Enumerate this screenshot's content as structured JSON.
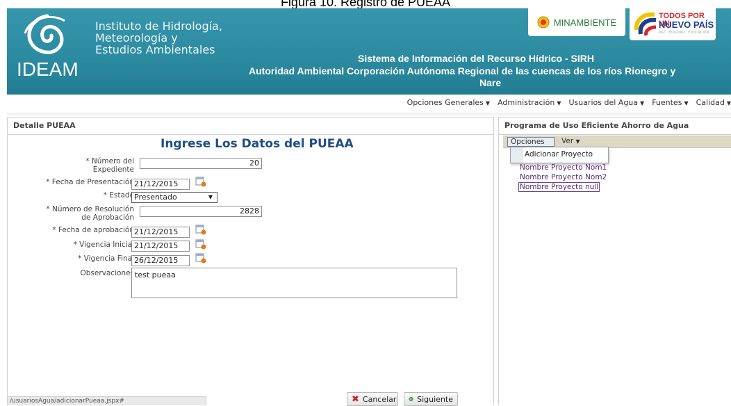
{
  "caption": "Figura 10. Registro de PUEAA",
  "header": {
    "logo_text": "IDEAM",
    "institution_lines": [
      "Instituto de Hidrología,",
      "Meteorología y",
      "Estudios Ambientales"
    ],
    "system_title": "Sistema de Información del Recurso Hídrico - SIRH",
    "authority_line1": "Autoridad Ambiental Corporación Autónoma Regional de las cuencas de los ríos Rionegro y",
    "authority_line2": "Nare",
    "ministry_logo": "MINAMBIENTE",
    "gov_logo_line1": "TODOS POR UN",
    "gov_logo_line2": "NUEVO PAÍS",
    "gov_logo_line3": "PAZ · EQUIDAD · EDUCACIÓN"
  },
  "nav": {
    "items": [
      "Opciones Generales",
      "Administración",
      "Usuarios del Agua",
      "Fuentes",
      "Calidad"
    ]
  },
  "left_panel": {
    "title": "Detalle PUEAA",
    "form_title": "Ingrese Los Datos del PUEAA",
    "fields": {
      "expediente_label_1": "* Número del",
      "expediente_label_2": "Expediente",
      "expediente_value": "20",
      "fecha_presentacion_label": "* Fecha de Presentación",
      "fecha_presentacion_value": "21/12/2015",
      "estado_label": "* Estado",
      "estado_value": "Presentado",
      "resolucion_label_1": "* Número de Resolución",
      "resolucion_label_2": "de Aprobación",
      "resolucion_value": "2828",
      "fecha_aprobacion_label": "* Fecha de aprobación",
      "fecha_aprobacion_value": "21/12/2015",
      "vigencia_inicial_label": "* Vigencia Inicial",
      "vigencia_inicial_value": "21/12/2015",
      "vigencia_final_label": "* Vigencia Final",
      "vigencia_final_value": "26/12/2015",
      "observaciones_label": "Observaciones",
      "observaciones_value": "test pueaa"
    },
    "buttons": {
      "cancel": "Cancelar",
      "next": "Siguiente"
    }
  },
  "right_panel": {
    "title": "Programa de Uso Eficiente Ahorro de Agua",
    "menu": {
      "opciones": "Opciones",
      "ver": "Ver"
    },
    "dropdown_item": "Adicionar Proyecto",
    "projects": [
      "Nombre Proyecto Nom1",
      "Nombre Proyecto Nom2",
      "Nombre Proyecto null"
    ]
  },
  "status_bar": "/usuariosAgua/adicionarPueaa.jspx#",
  "colors": {
    "header_bg": "#2b8aa0",
    "title_blue": "#1f4d86",
    "project_link": "#5a2a7a"
  }
}
